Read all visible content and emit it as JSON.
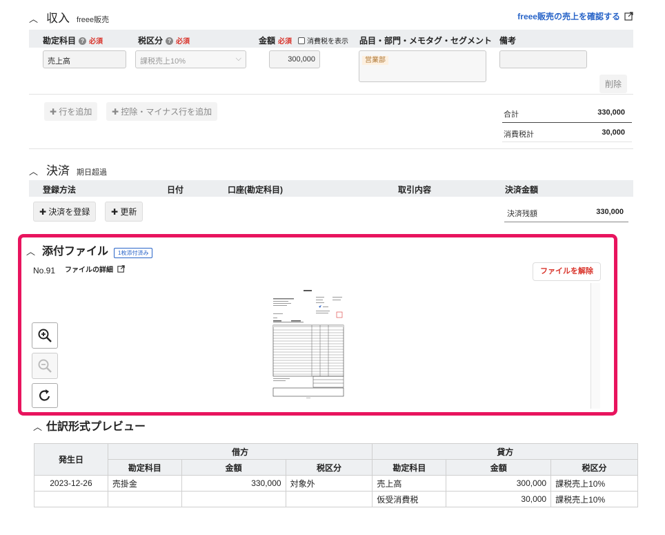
{
  "income": {
    "title": "収入",
    "subtitle": "freee販売",
    "confirm_link": "freee販売の売上を確認する",
    "headers": {
      "account": "勘定科目",
      "tax": "税区分",
      "amount": "金額",
      "required": "必須",
      "tax_display": "消費税を表示",
      "items": "品目・部門・メモタグ・セグメント",
      "memo": "備考"
    },
    "row": {
      "account": "売上高",
      "tax": "課税売上10%",
      "amount": "300,000",
      "tag": "営業部",
      "delete": "削除"
    },
    "add_row": "行を追加",
    "add_deduction": "控除・マイナス行を追加",
    "total_label": "合計",
    "total_value": "330,000",
    "tax_total_label": "消費税計",
    "tax_total_value": "30,000"
  },
  "settlement": {
    "title": "決済",
    "subtitle": "期日超過",
    "headers": {
      "method": "登録方法",
      "date": "日付",
      "account": "口座(勘定科目)",
      "content": "取引内容",
      "amount": "決済金額"
    },
    "register_button": "決済を登録",
    "update_button": "更新",
    "balance_label": "決済残額",
    "balance_value": "330,000"
  },
  "attachment": {
    "title": "添付ファイル",
    "badge": "1枚添付済み",
    "number": "No.91",
    "details_link": "ファイルの詳細",
    "detach_button": "ファイルを解除",
    "accent": "#e8145e"
  },
  "journal": {
    "title": "仕訳形式プレビュー",
    "date_header": "発生日",
    "debit_header": "借方",
    "credit_header": "貸方",
    "sub_headers": [
      "勘定科目",
      "金額",
      "税区分",
      "勘定科目",
      "金額",
      "税区分"
    ],
    "rows": [
      {
        "date": "2023-12-26",
        "d_account": "売掛金",
        "d_amount": "330,000",
        "d_tax": "対象外",
        "c_account": "売上高",
        "c_amount": "300,000",
        "c_tax": "課税売上10%"
      },
      {
        "date": "",
        "d_account": "",
        "d_amount": "",
        "d_tax": "",
        "c_account": "仮受消費税",
        "c_amount": "30,000",
        "c_tax": "課税売上10%"
      }
    ]
  },
  "icons": {
    "zoom_in": "zoom-in-icon",
    "zoom_out": "zoom-out-icon",
    "rotate": "rotate-icon",
    "external": "external-link-icon"
  }
}
